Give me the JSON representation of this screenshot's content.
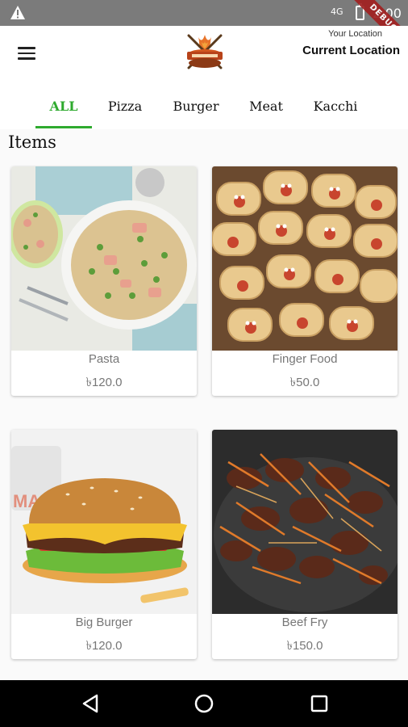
{
  "status_bar": {
    "signal": "4G",
    "time": "2:00",
    "debug_label": "DEBUG"
  },
  "header": {
    "location_label": "Your Location",
    "location_value": "Current Location"
  },
  "tabs": [
    {
      "label": "ALL",
      "active": true
    },
    {
      "label": "Pizza",
      "active": false
    },
    {
      "label": "Burger",
      "active": false
    },
    {
      "label": "Meat",
      "active": false
    },
    {
      "label": "Kacchi",
      "active": false
    }
  ],
  "section_title": "Items",
  "items": [
    {
      "name": "Pasta",
      "price": "৳120.0",
      "image": "pasta-photo"
    },
    {
      "name": "Finger Food",
      "price": "৳50.0",
      "image": "finger-food-photo"
    },
    {
      "name": "Big Burger",
      "price": "৳120.0",
      "image": "burger-photo"
    },
    {
      "name": "Beef Fry",
      "price": "৳150.0",
      "image": "beef-fry-photo"
    }
  ],
  "colors": {
    "accent": "#2eaa2e",
    "status_bar": "#7b7b7b",
    "nav_bar": "#000000"
  },
  "nav": {
    "back": "back-icon",
    "home": "home-icon",
    "recents": "recents-icon"
  }
}
